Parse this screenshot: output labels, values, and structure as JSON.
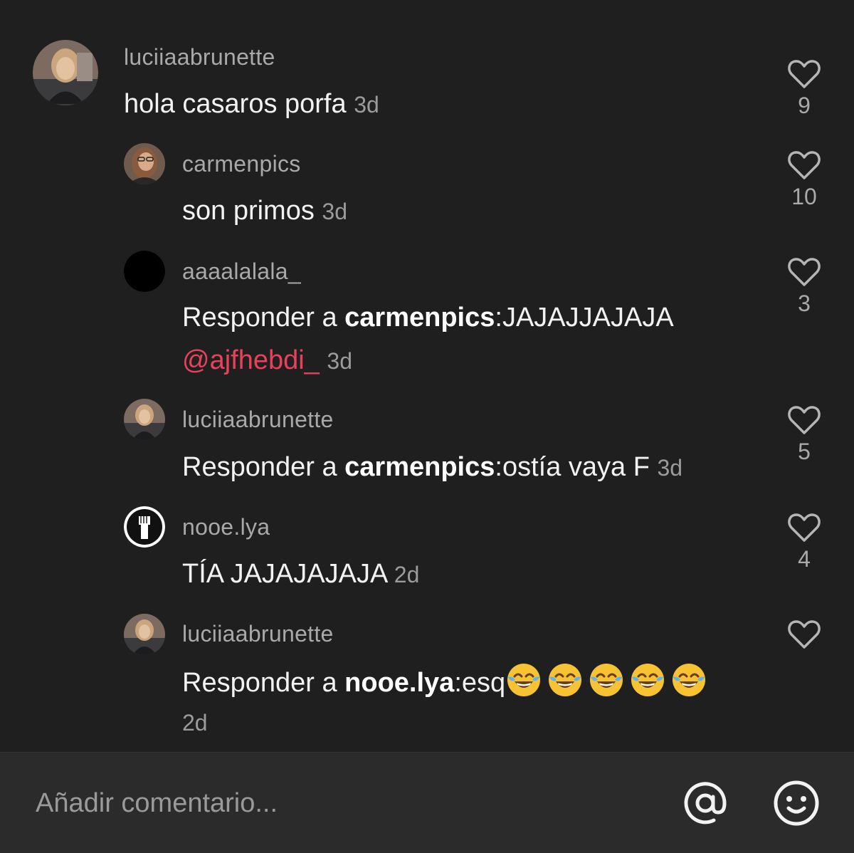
{
  "comments": [
    {
      "username": "luciiaabrunette",
      "text": "hola casaros porfa",
      "time": "3d",
      "likes": "9",
      "avatar": "photo-girl"
    },
    {
      "username": "carmenpics",
      "text": "son primos",
      "time": "3d",
      "likes": "10",
      "avatar": "photo-glasses"
    },
    {
      "username": "aaaalalala_",
      "reply_prefix": "Responder a ",
      "reply_to": "carmenpics",
      "text": ":JAJAJJAJAJA",
      "mention": "@ajfhebdi_",
      "time": "3d",
      "likes": "3",
      "avatar": "black-circle"
    },
    {
      "username": "luciiaabrunette",
      "reply_prefix": "Responder a ",
      "reply_to": "carmenpics",
      "text": ":ostía vaya F",
      "time": "3d",
      "likes": "5",
      "avatar": "photo-girl"
    },
    {
      "username": "nooe.lya",
      "text": "TÍA JAJAJAJAJA",
      "time": "2d",
      "likes": "4",
      "avatar": "raised-fist"
    },
    {
      "username": "luciiaabrunette",
      "reply_prefix": "Responder a ",
      "reply_to": "nooe.lya",
      "text": ":esq",
      "emoji": "face-with-tears-of-joy",
      "emoji_count": 5,
      "time": "2d",
      "likes": "",
      "avatar": "photo-girl"
    }
  ],
  "composer": {
    "placeholder": "Añadir comentario...",
    "mention_icon": "at-icon",
    "emoji_icon": "smiley-icon"
  },
  "colors": {
    "background": "#1f1f1f",
    "composer": "#2b2b2b",
    "mention": "#e8425b"
  }
}
